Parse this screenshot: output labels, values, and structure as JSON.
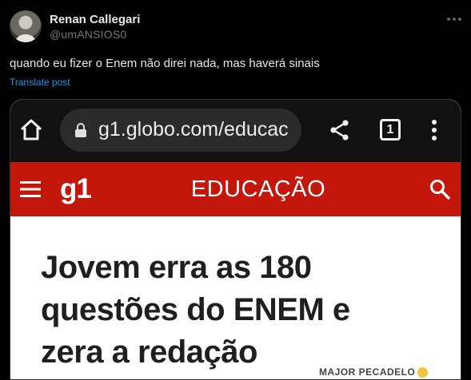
{
  "tweet": {
    "display_name": "Renan Callegari",
    "handle": "@umANSIOS0",
    "text": "quando eu fizer o Enem não direi nada, mas haverá sinais",
    "translate_label": "Translate post"
  },
  "media": {
    "browser": {
      "url": "g1.globo.com/educac",
      "tab_count": "1"
    },
    "site": {
      "logo": "g1",
      "section": "EDUCAÇÃO",
      "brand_color": "#c4170c"
    },
    "headline_lines": [
      "Jovem erra as 180",
      "questões do ENEM e",
      "zera a redação"
    ],
    "watermark": "MAJOR PECADELO"
  }
}
